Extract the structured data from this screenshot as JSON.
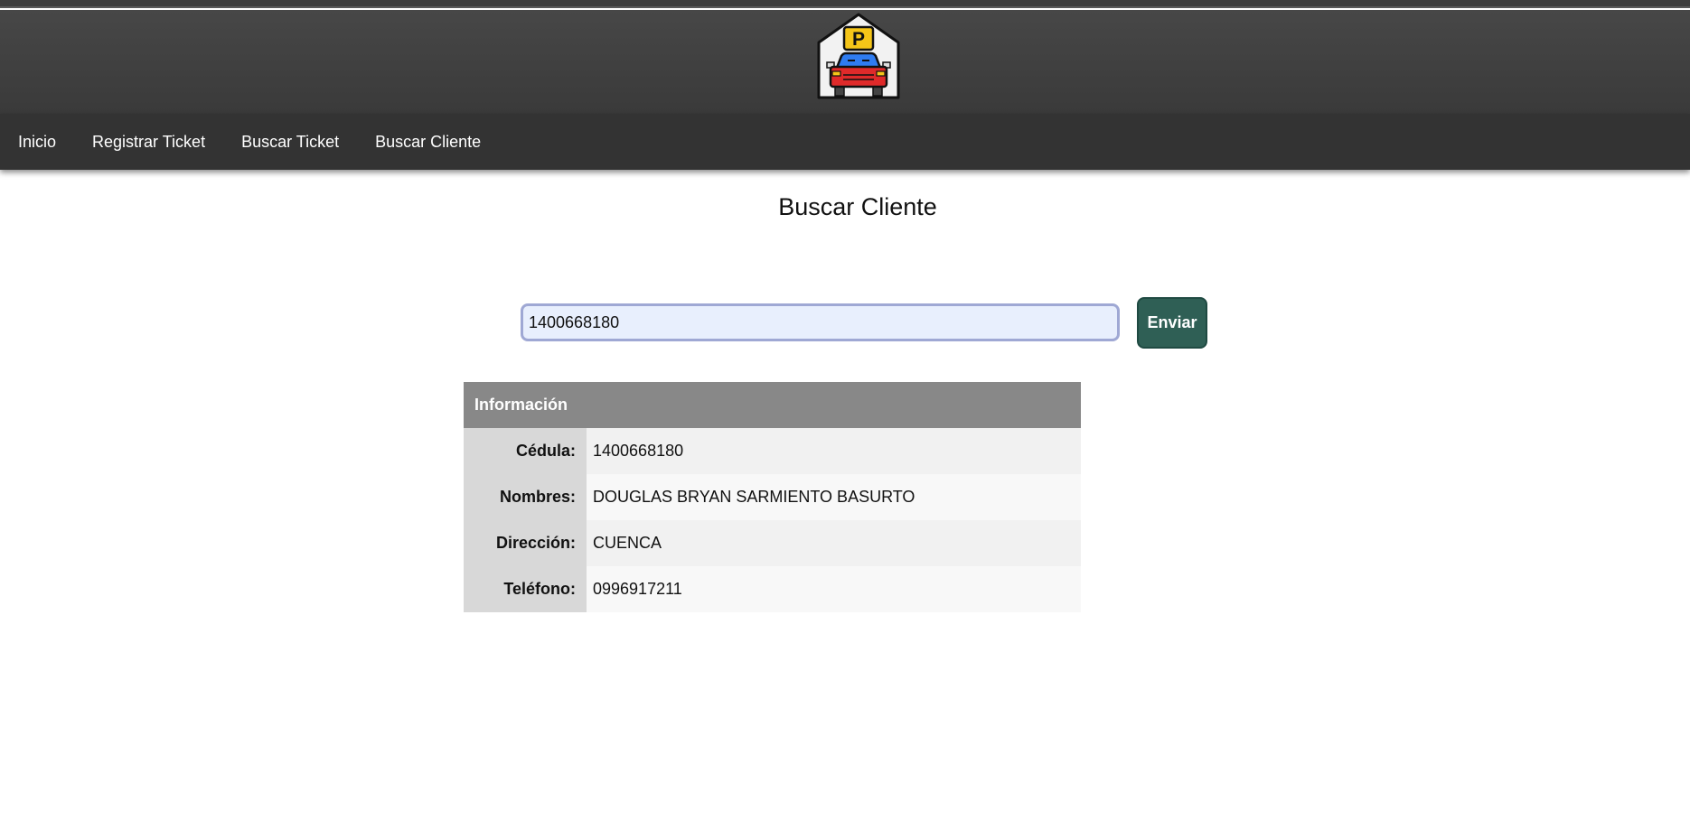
{
  "header": {
    "logo_icon": "parking-garage-car-icon",
    "logo_letter": "P"
  },
  "nav": {
    "items": [
      {
        "label": "Inicio"
      },
      {
        "label": "Registrar Ticket"
      },
      {
        "label": "Buscar Ticket"
      },
      {
        "label": "Buscar Cliente"
      }
    ]
  },
  "page": {
    "title": "Buscar Cliente"
  },
  "search": {
    "value": "1400668180",
    "button_label": "Enviar"
  },
  "info": {
    "header": "Información",
    "rows": [
      {
        "label": "Cédula:",
        "value": "1400668180"
      },
      {
        "label": "Nombres:",
        "value": "DOUGLAS BRYAN SARMIENTO BASURTO"
      },
      {
        "label": "Dirección:",
        "value": "CUENCA"
      },
      {
        "label": "Teléfono:",
        "value": "0996917211"
      }
    ]
  },
  "colors": {
    "header_bg": "#444444",
    "nav_bg": "#333333",
    "button_bg": "#2f5f55",
    "table_header_bg": "#888888",
    "input_bg": "#e8effd"
  }
}
